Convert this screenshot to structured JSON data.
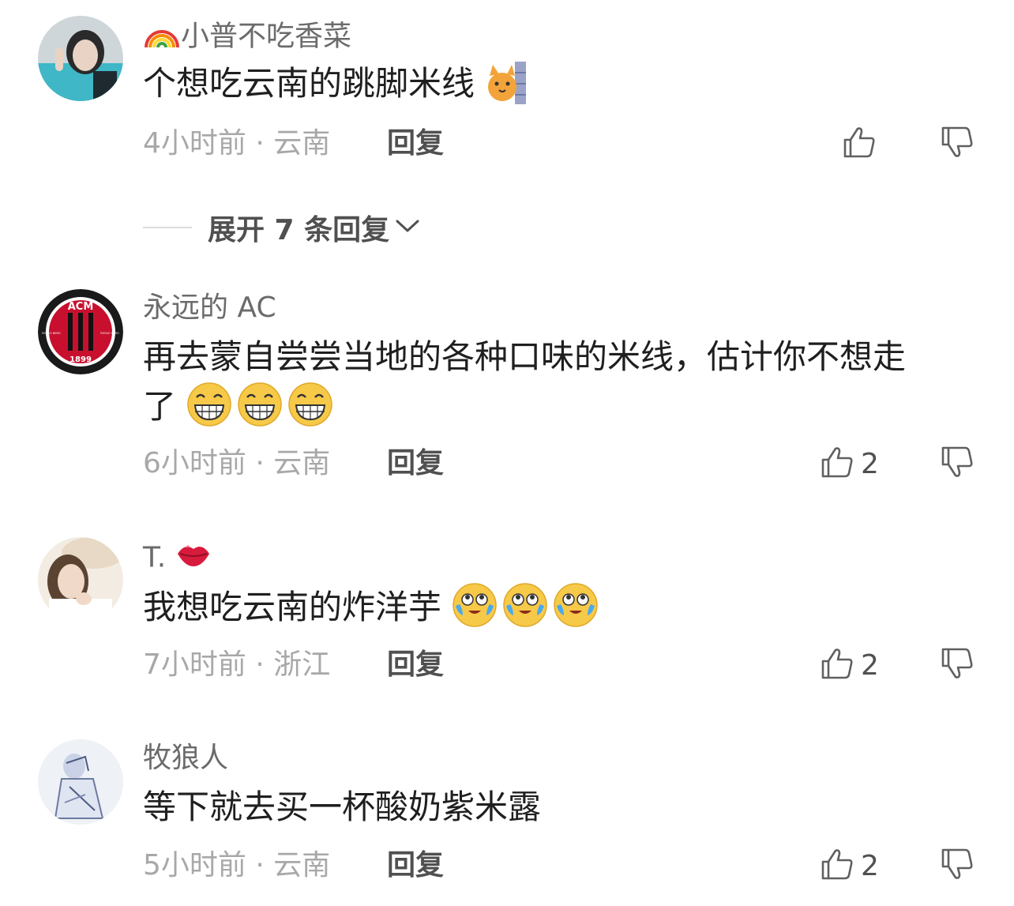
{
  "comments": [
    {
      "username": "小普不吃香菜",
      "username_emoji": "rainbow-icon",
      "text": "个想吃云南的跳脚米线",
      "text_emojis": [
        "cat-wall-emoji"
      ],
      "time": "4小时前",
      "location": "云南",
      "reply_label": "回复",
      "likes": ""
    },
    {
      "username": "永远的 AC",
      "text_line1": "再去蒙自尝尝当地的各种口味的米线，估计你不想走",
      "text_line2": "了",
      "text_emojis": [
        "grin-emoji",
        "grin-emoji",
        "grin-emoji"
      ],
      "time": "6小时前",
      "location": "云南",
      "reply_label": "回复",
      "likes": "2"
    },
    {
      "username": "T.",
      "username_emoji": "lips-icon",
      "text": "我想吃云南的炸洋芋",
      "text_emojis": [
        "tears-joy-emoji",
        "tears-joy-emoji",
        "tears-joy-emoji"
      ],
      "time": "7小时前",
      "location": "浙江",
      "reply_label": "回复",
      "likes": "2"
    },
    {
      "username": "牧狼人",
      "text": "等下就去买一杯酸奶紫米露",
      "time": "5小时前",
      "location": "云南",
      "reply_label": "回复",
      "likes": "2"
    }
  ],
  "expand_replies": "展开 7 条回复",
  "meta_separator": " · ",
  "acm_logo": {
    "top": "ACM",
    "year": "1899",
    "left_side": "ROSSO NERO",
    "right_side": "ROSSO NERO"
  },
  "colors": {
    "text_primary": "#1f1f1f",
    "text_secondary": "#6b6b6b",
    "meta": "#a8a8a8",
    "emoji_yellow": "#f7c948",
    "acm_red": "#c8102e"
  }
}
